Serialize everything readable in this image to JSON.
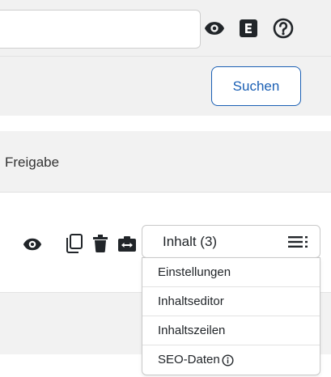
{
  "toolbar": {
    "icons": [
      "file-plus-icon",
      "list-icon",
      "eye-slash-icon",
      "eye-icon",
      "e-square-icon",
      "question-circle-icon"
    ]
  },
  "search": {
    "value": "",
    "placeholder": "",
    "button_label": "Suchen"
  },
  "table": {
    "columns": [
      "Freigabe"
    ]
  },
  "row": {
    "actions": [
      "eye-icon",
      "copy-icon",
      "trash-icon",
      "swap-icon"
    ]
  },
  "dropdown": {
    "label": "Inhalt (3)",
    "icon": "menu-lines-icon",
    "items": [
      "Einstellungen",
      "Inhaltseditor",
      "Inhaltszeilen",
      "SEO-Daten"
    ],
    "seo_info_icon": "info-circle-icon"
  },
  "colors": {
    "toolbar_bg": "#f1f1f1",
    "accent_blue": "#1a5fb4",
    "icon_dark": "#212529"
  }
}
